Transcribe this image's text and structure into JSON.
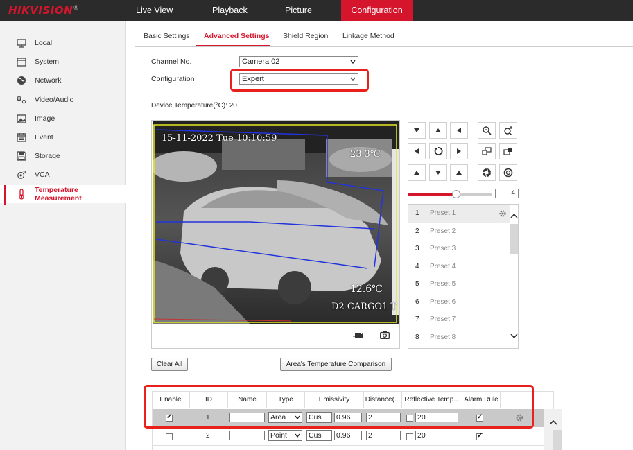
{
  "brand": {
    "name": "HIKVISION",
    "reg": "®"
  },
  "topnav": [
    {
      "label": "Live View",
      "active": false
    },
    {
      "label": "Playback",
      "active": false
    },
    {
      "label": "Picture",
      "active": false
    },
    {
      "label": "Configuration",
      "active": true
    }
  ],
  "sidebar": [
    {
      "label": "Local",
      "icon": "monitor-icon"
    },
    {
      "label": "System",
      "icon": "system-icon"
    },
    {
      "label": "Network",
      "icon": "globe-icon"
    },
    {
      "label": "Video/Audio",
      "icon": "video-audio-icon"
    },
    {
      "label": "Image",
      "icon": "image-icon"
    },
    {
      "label": "Event",
      "icon": "calendar-icon"
    },
    {
      "label": "Storage",
      "icon": "storage-icon"
    },
    {
      "label": "VCA",
      "icon": "vca-icon"
    },
    {
      "label": "Temperature Measurement",
      "icon": "thermometer-icon",
      "active": true
    }
  ],
  "subtabs": [
    {
      "label": "Basic Settings"
    },
    {
      "label": "Advanced Settings",
      "active": true
    },
    {
      "label": "Shield Region"
    },
    {
      "label": "Linkage Method"
    }
  ],
  "form": {
    "channel_label": "Channel No.",
    "channel_value": "Camera 02",
    "config_label": "Configuration",
    "config_value": "Expert",
    "device_temp": "Device Temperature(°C): 20"
  },
  "video": {
    "timestamp": "15-11-2022 Tue 10:10:59",
    "temp_high": "23.3℃",
    "temp_low": "12.6℃",
    "channel_osd": "D2 CARGO1 T"
  },
  "ptz": {
    "speed": "4",
    "speed_level": 4,
    "speed_max": 7
  },
  "presets": [
    {
      "id": "1",
      "name": "Preset 1"
    },
    {
      "id": "2",
      "name": "Preset 2"
    },
    {
      "id": "3",
      "name": "Preset 3"
    },
    {
      "id": "4",
      "name": "Preset 4"
    },
    {
      "id": "5",
      "name": "Preset 5"
    },
    {
      "id": "6",
      "name": "Preset 6"
    },
    {
      "id": "7",
      "name": "Preset 7"
    },
    {
      "id": "8",
      "name": "Preset 8"
    }
  ],
  "buttons": {
    "clear_all": "Clear All",
    "compare": "Area's Temperature Comparison"
  },
  "table": {
    "headers": [
      "Enable",
      "ID",
      "Name",
      "Type",
      "Emissivity",
      "Distance(...",
      "Reflective Temp...",
      "Alarm Rule"
    ],
    "rows": [
      {
        "enable": true,
        "id": "1",
        "name": "",
        "type": "Area",
        "emis_mode": "Cus",
        "emissivity": "0.96",
        "distance": "2",
        "reflective_on": false,
        "reflective": "20",
        "alarm": true
      },
      {
        "enable": false,
        "id": "2",
        "name": "",
        "type": "Point",
        "emis_mode": "Cus",
        "emissivity": "0.96",
        "distance": "2",
        "reflective_on": false,
        "reflective": "20",
        "alarm": true
      }
    ]
  },
  "colors": {
    "accent": "#d4152c",
    "highlight": "#e8211d"
  }
}
